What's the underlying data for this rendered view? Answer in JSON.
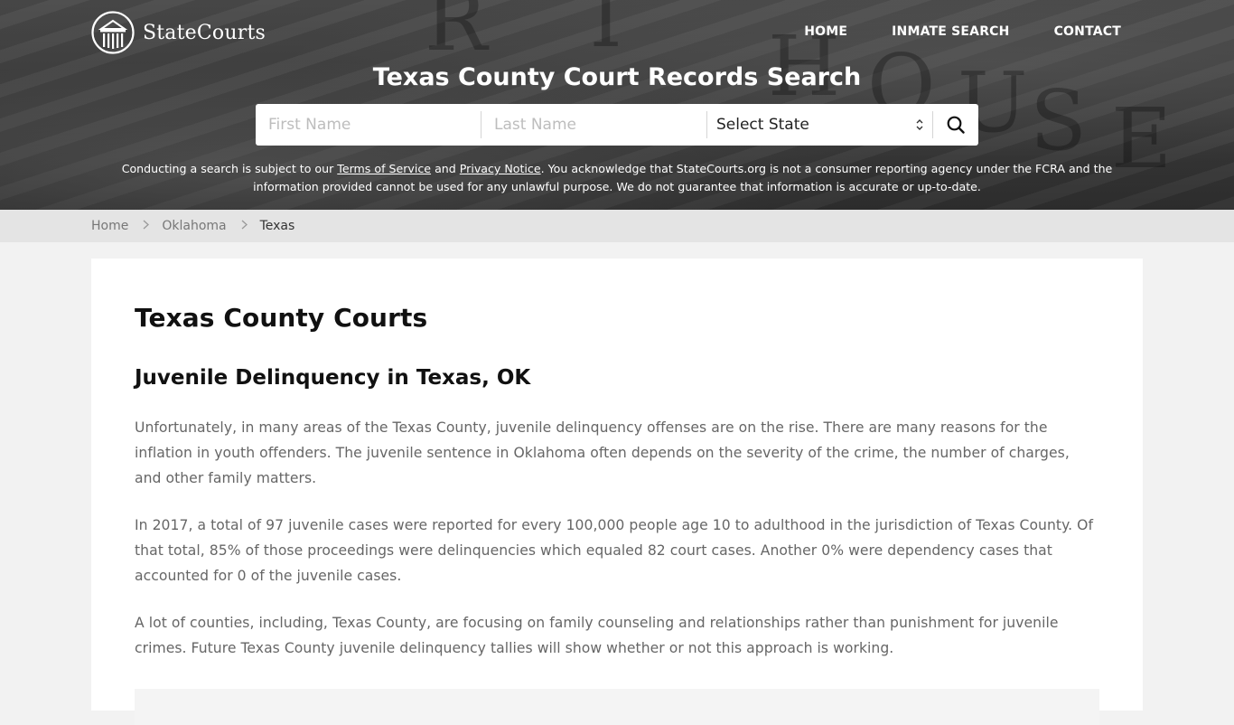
{
  "brand": {
    "name": "StateCourts",
    "logo_icon": "courthouse-columns-icon"
  },
  "nav": {
    "items": [
      {
        "label": "HOME"
      },
      {
        "label": "INMATE SEARCH"
      },
      {
        "label": "CONTACT"
      }
    ]
  },
  "hero": {
    "title": "Texas County Court Records Search",
    "background_letters": [
      "R",
      "T",
      "H",
      "O",
      "U",
      "S",
      "E"
    ]
  },
  "search": {
    "first_name_placeholder": "First Name",
    "last_name_placeholder": "Last Name",
    "state_value": "Select State",
    "submit_icon": "search-icon"
  },
  "disclaimer": {
    "prefix": "Conducting a search is subject to our ",
    "terms_link": "Terms of Service",
    "and": " and ",
    "privacy_link": "Privacy Notice",
    "suffix": ". You acknowledge that StateCourts.org is not a consumer reporting agency under the FCRA and the information provided cannot be used for any unlawful purpose. We do not guarantee that information is accurate or up-to-date."
  },
  "breadcrumb": {
    "items": [
      {
        "label": "Home"
      },
      {
        "label": "Oklahoma"
      }
    ],
    "current": "Texas"
  },
  "content": {
    "title": "Texas County Courts",
    "section_heading": "Juvenile Delinquency in Texas, OK",
    "paragraphs": [
      "Unfortunately, in many areas of the Texas County, juvenile delinquency offenses are on the rise. There are many reasons for the inflation in youth offenders. The juvenile sentence in Oklahoma often depends on the severity of the crime, the number of charges, and other family matters.",
      "In 2017, a total of 97 juvenile cases were reported for every 100,000 people age 10 to adulthood in the jurisdiction of Texas County. Of that total, 85% of those proceedings were delinquencies which equaled 82 court cases. Another 0% were dependency cases that accounted for 0 of the juvenile cases.",
      "A lot of counties, including, Texas County, are focusing on family counseling and relationships rather than punishment for juvenile crimes. Future Texas County juvenile delinquency tallies will show whether or not this approach is working."
    ]
  },
  "colors": {
    "page_background": "#f2f2f2",
    "breadcrumb_bar": "#e4e4e4",
    "card_background": "#ffffff",
    "heading_text": "#111111",
    "body_text": "#666666"
  }
}
